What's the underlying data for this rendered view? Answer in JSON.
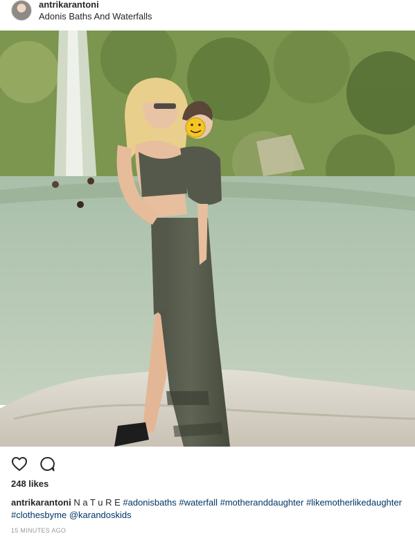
{
  "post": {
    "username": "antrikarantoni",
    "location": "Adonis Baths And Waterfalls",
    "likes": "248 likes",
    "caption": {
      "username": "antrikarantoni",
      "text": "N a T u R E",
      "hashtags": [
        "#adonisbaths",
        "#waterfall",
        "#motheranddaughter",
        "#likemotherlikedaughter",
        "#clothesbyme",
        "@karandoskids"
      ]
    },
    "timestamp": "15 MINUTES AGO",
    "actions": {
      "like_icon": "heart-icon",
      "comment_icon": "comment-icon"
    },
    "photo": {
      "description_icon": "photo",
      "face_emoji": "🙂"
    }
  }
}
